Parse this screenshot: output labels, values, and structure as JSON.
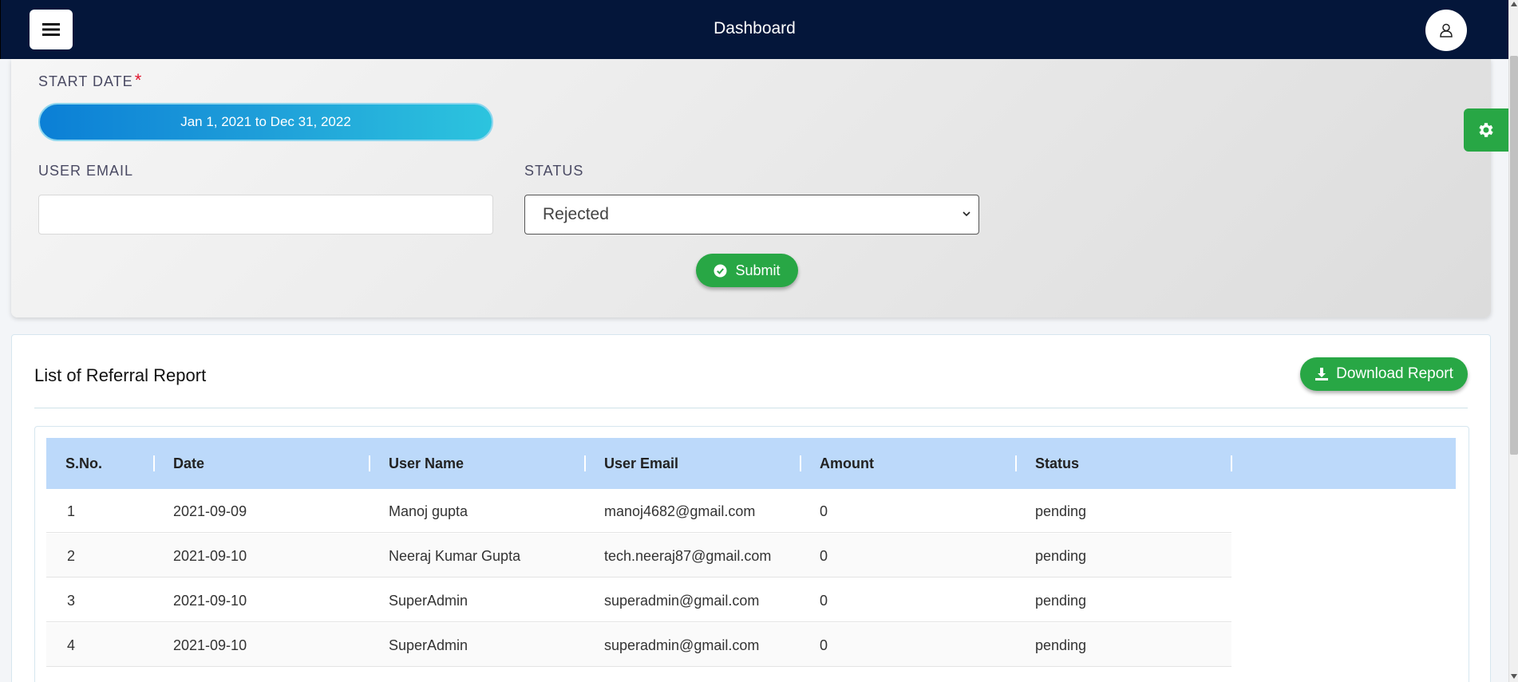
{
  "header": {
    "title": "Dashboard",
    "menu_icon": "hamburger-icon",
    "user_icon": "user-icon"
  },
  "filters": {
    "start_date_label": "START DATE",
    "required_mark": "*",
    "date_range_value": "Jan 1, 2021 to Dec 31, 2022",
    "user_email_label": "USER EMAIL",
    "user_email_value": "",
    "status_label": "STATUS",
    "status_selected": "Rejected",
    "submit_label": "Submit"
  },
  "report": {
    "title": "List of Referral Report",
    "download_label": "Download Report",
    "columns": [
      "S.No.",
      "Date",
      "User Name",
      "User Email",
      "Amount",
      "Status"
    ],
    "rows": [
      {
        "sno": "1",
        "date": "2021-09-09",
        "name": "Manoj gupta",
        "email": "manoj4682@gmail.com",
        "amount": "0",
        "status": "pending"
      },
      {
        "sno": "2",
        "date": "2021-09-10",
        "name": "Neeraj Kumar Gupta",
        "email": "tech.neeraj87@gmail.com",
        "amount": "0",
        "status": "pending"
      },
      {
        "sno": "3",
        "date": "2021-09-10",
        "name": "SuperAdmin",
        "email": "superadmin@gmail.com",
        "amount": "0",
        "status": "pending"
      },
      {
        "sno": "4",
        "date": "2021-09-10",
        "name": "SuperAdmin",
        "email": "superadmin@gmail.com",
        "amount": "0",
        "status": "pending"
      }
    ]
  },
  "colors": {
    "navbar": "#04163a",
    "accent_green": "#28a745",
    "table_header": "#bcd9fa",
    "date_gradient_start": "#0b7fd6",
    "date_gradient_end": "#2cc4de"
  }
}
